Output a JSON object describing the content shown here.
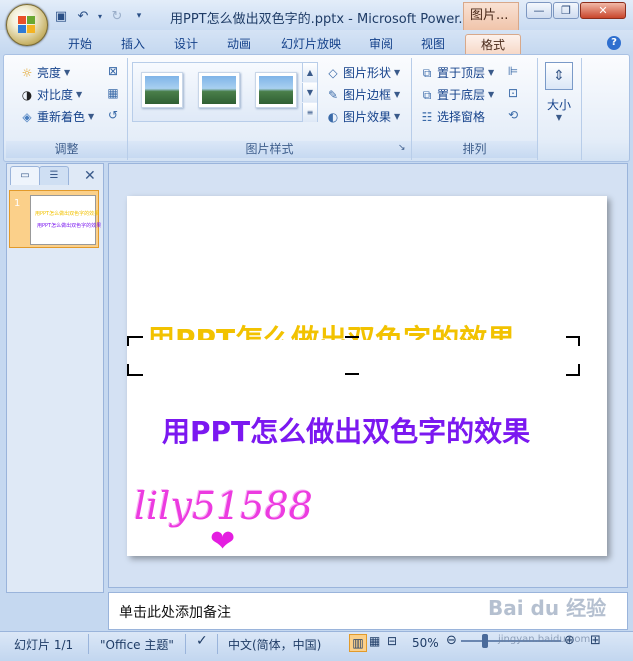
{
  "titlebar": {
    "quick_access": [
      "save-icon",
      "undo-icon",
      "redo-icon",
      "customize-arrow"
    ],
    "title": "用PPT怎么做出双色字的.pptx - Microsoft Power...",
    "context_tab": "图片..."
  },
  "window_buttons": {
    "minimize": "—",
    "restore": "❐",
    "close": "✕"
  },
  "tabs": [
    "开始",
    "插入",
    "设计",
    "动画",
    "幻灯片放映",
    "审阅",
    "视图",
    "格式"
  ],
  "help": "?",
  "ribbon": {
    "adjust": {
      "label": "调整",
      "items": [
        "亮度",
        "对比度",
        "重新着色"
      ]
    },
    "picture_styles": {
      "label": "图片样式",
      "items": [
        "图片形状",
        "图片边框",
        "图片效果"
      ]
    },
    "arrange": {
      "label": "排列",
      "items": [
        "置于顶层",
        "置于底层",
        "选择窗格"
      ]
    },
    "size": {
      "label": "大小"
    }
  },
  "slides_pane": {
    "slide_number": "1",
    "thumb_line1": "用PPT怎么做出双色字的效果",
    "thumb_line2": "用PPT怎么做出双色字的效果"
  },
  "slide": {
    "yellow_text": "用PPT怎么做出双色字的效果",
    "purple_text": "用PPT怎么做出双色字的效果",
    "watermark": "lily51588",
    "colors": {
      "yellow": "#f2c200",
      "purple": "#7b18f0",
      "watermark": "#ec3be0"
    }
  },
  "notes_placeholder": "单击此处添加备注",
  "statusbar": {
    "slide_info": "幻灯片 1/1",
    "theme": "\"Office 主题\"",
    "language": "中文(简体，中国)",
    "zoom": "50%",
    "zoom_level": 0.5,
    "baidu_watermark": "Bai du 经验",
    "baidu_url": "jingyan.baidu.com"
  }
}
